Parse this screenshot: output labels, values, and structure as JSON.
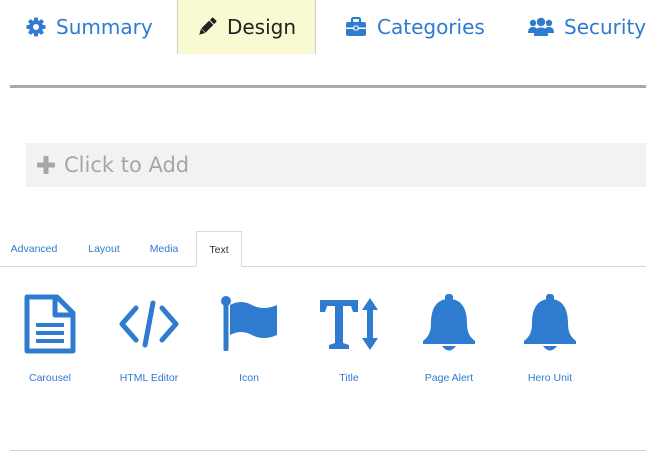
{
  "top_tabs": [
    {
      "label": "Summary",
      "icon": "gear-icon",
      "active": false
    },
    {
      "label": "Design",
      "icon": "pencil-icon",
      "active": true
    },
    {
      "label": "Categories",
      "icon": "briefcase-icon",
      "active": false
    },
    {
      "label": "Security",
      "icon": "users-icon",
      "active": false
    }
  ],
  "add_bar": {
    "label": "Click to Add",
    "icon": "plus-icon"
  },
  "sub_tabs": [
    {
      "label": "Advanced",
      "active": false
    },
    {
      "label": "Layout",
      "active": false
    },
    {
      "label": "Media",
      "active": false
    },
    {
      "label": "Text",
      "active": true
    }
  ],
  "widgets": [
    {
      "label": "Carousel",
      "icon": "document-icon"
    },
    {
      "label": "HTML Editor",
      "icon": "code-icon"
    },
    {
      "label": "Icon",
      "icon": "flag-icon"
    },
    {
      "label": "Title",
      "icon": "text-height-icon"
    },
    {
      "label": "Page Alert",
      "icon": "bell-icon"
    },
    {
      "label": "Hero Unit",
      "icon": "bell-icon"
    }
  ],
  "colors": {
    "accent": "#2f7bd0",
    "active_tab_bg": "#fafad2",
    "add_bar_bg": "#f2f2f2",
    "muted": "#a6a6a6"
  }
}
